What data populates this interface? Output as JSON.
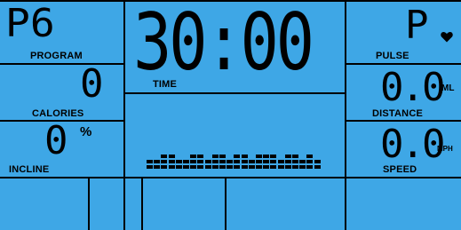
{
  "program": {
    "value": "P6",
    "label": "PROGRAM"
  },
  "time": {
    "value": "30:00",
    "label": "TIME"
  },
  "pulse": {
    "value": "P",
    "label": "PULSE",
    "icon": "heart-icon"
  },
  "calories": {
    "value": "0",
    "label": "CALORIES"
  },
  "distance": {
    "value": "0.0",
    "unit": "ML",
    "label": "DISTANCE"
  },
  "incline": {
    "value": "0",
    "unit": "%",
    "label": "INCLINE"
  },
  "speed": {
    "value": "0.0",
    "unit": "MPH",
    "label": "SPEED"
  },
  "profile": {
    "levels": [
      1,
      1,
      2,
      2,
      1,
      1,
      2,
      2,
      1,
      2,
      2,
      1,
      2,
      2,
      1,
      2,
      2,
      2,
      1,
      2,
      2,
      1,
      2,
      1
    ]
  },
  "colors": {
    "background": "#3ea7e6",
    "segments": "#000000"
  }
}
